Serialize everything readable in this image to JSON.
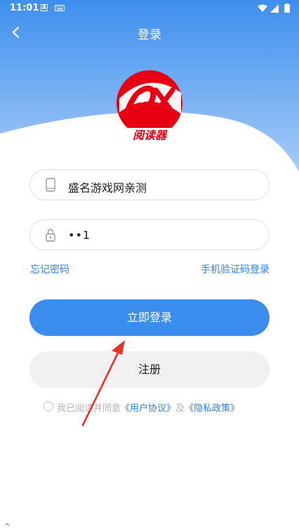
{
  "status_bar": {
    "time": "11:01",
    "a_label": "A"
  },
  "header": {
    "title": "登录"
  },
  "logo": {
    "text": "阅读器",
    "mark": "9X"
  },
  "form": {
    "username_value": "盛名游戏网亲测",
    "password_value": "••1"
  },
  "links": {
    "forgot_password": "忘记密码",
    "sms_login": "手机验证码登录"
  },
  "buttons": {
    "login": "立即登录",
    "register": "注册"
  },
  "agreement": {
    "prefix": "我已阅读并同意",
    "user_agreement": "《用户协议》",
    "conjunction": "及",
    "privacy_policy": "《隐私政策》"
  },
  "colors": {
    "accent": "#3b8ded",
    "link": "#2d82f0",
    "logo_red": "#e60012"
  }
}
